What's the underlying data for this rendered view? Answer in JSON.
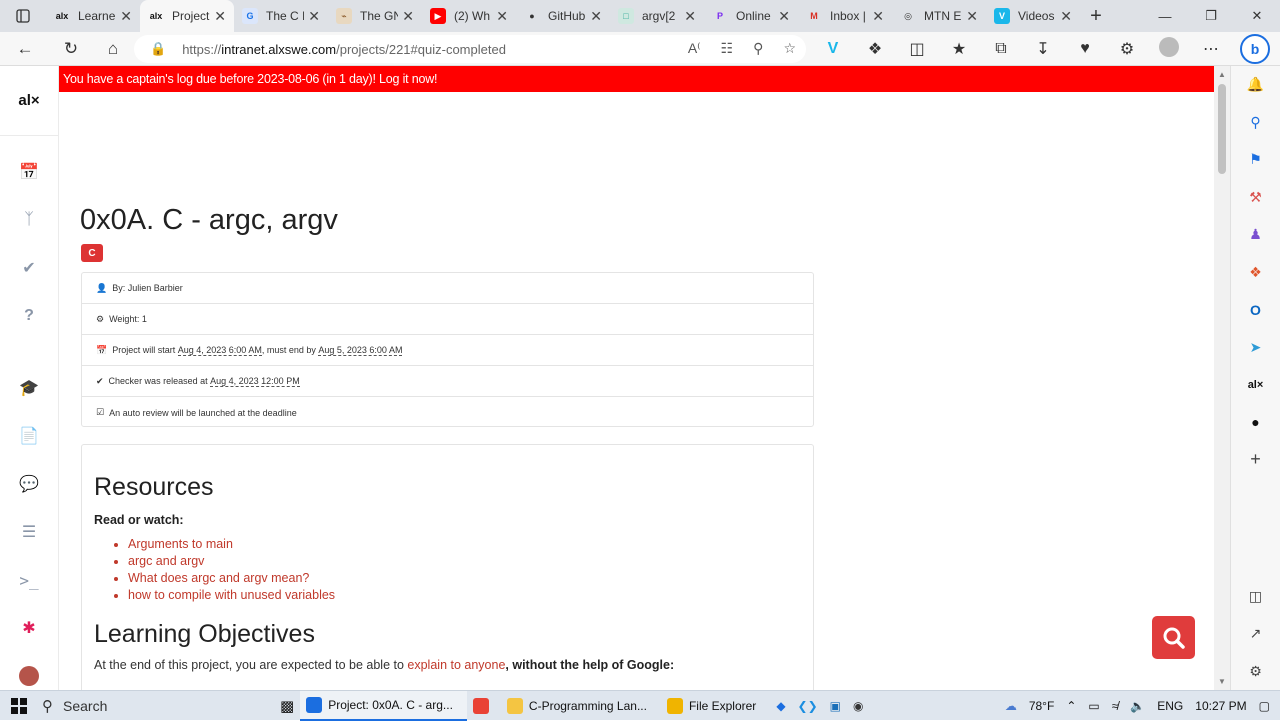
{
  "browser": {
    "tabs": [
      {
        "label": "Learne",
        "fav": "alx",
        "favcolor": "#111",
        "favbg": "#dee1e6",
        "active": false
      },
      {
        "label": "Project",
        "fav": "alx",
        "favcolor": "#111",
        "favbg": "#f7f7f7",
        "active": true
      },
      {
        "label": "The C I",
        "fav": "G",
        "favcolor": "#1a73e8",
        "favbg": "#dbe6fb",
        "active": false
      },
      {
        "label": "The GN",
        "fav": "⌁",
        "favcolor": "#8a5a2b",
        "favbg": "#e8d8c0",
        "active": false
      },
      {
        "label": "(2) Wh",
        "fav": "▶",
        "favcolor": "#fff",
        "favbg": "#ff0000",
        "active": false
      },
      {
        "label": "GitHub",
        "fav": "●",
        "favcolor": "#333",
        "favbg": "#dee1e6",
        "active": false
      },
      {
        "label": "argv[2",
        "fav": "□",
        "favcolor": "#3a9",
        "favbg": "#cfe8e0",
        "active": false
      },
      {
        "label": "Online",
        "fav": "P",
        "favcolor": "#7a2cf0",
        "favbg": "#dee1e6",
        "active": false
      },
      {
        "label": "Inbox |",
        "fav": "M",
        "favcolor": "#d93025",
        "favbg": "#dee1e6",
        "active": false
      },
      {
        "label": "MTN E",
        "fav": "◎",
        "favcolor": "#333",
        "favbg": "#dee1e6",
        "active": false
      },
      {
        "label": "Videos",
        "fav": "V",
        "favcolor": "#fff",
        "favbg": "#1ab7ea",
        "active": false
      }
    ],
    "close_glyph": "✕",
    "new_tab_glyph": "+",
    "url_scheme": "https://",
    "url_host": "intranet.alxswe.com",
    "url_path": "/projects/221#quiz-completed"
  },
  "alx": {
    "logo": "al×",
    "banner": "You have a captain's log due before 2023-08-06 (in 1 day)! Log it now!"
  },
  "project": {
    "title": "0x0A. C - argc, argv",
    "tag": "C",
    "author": "By: Julien Barbier",
    "weight": "Weight: 1",
    "start_prefix": "Project will start ",
    "start_date": "Aug 4, 2023 6:00 AM",
    "end_prefix": ", must end by ",
    "end_date": "Aug 5, 2023 6:00 AM",
    "checker_prefix": "Checker was released at ",
    "checker_date": "Aug 4, 2023 12:00 PM",
    "auto_review": "An auto review will be launched at the deadline"
  },
  "resources": {
    "heading": "Resources",
    "subheading": "Read or watch:",
    "links": [
      "Arguments to main",
      "argc and argv",
      "What does argc and argv mean?",
      "how to compile with unused variables"
    ]
  },
  "objectives": {
    "heading": "Learning Objectives",
    "intro": "At the end of this project, you are expected to be able to ",
    "link": "explain to anyone",
    "suffix": ", without the help of Google:"
  },
  "taskbar": {
    "search": "Search",
    "apps": [
      {
        "label": "Project: 0x0A. C - arg...",
        "color": "#1b6ee0",
        "active": true
      },
      {
        "label": "",
        "color": "#e94235",
        "active": false
      },
      {
        "label": "C-Programming Lan...",
        "color": "#f4c542",
        "active": false
      },
      {
        "label": "File Explorer",
        "color": "#f0b400",
        "active": false
      }
    ],
    "weather": "78°F",
    "lang": "ENG",
    "time": "10:27 PM"
  },
  "colors": {
    "banner": "#ff0000",
    "link": "#c0392b",
    "tag": "#dd3333",
    "fab": "#e03c3c"
  }
}
